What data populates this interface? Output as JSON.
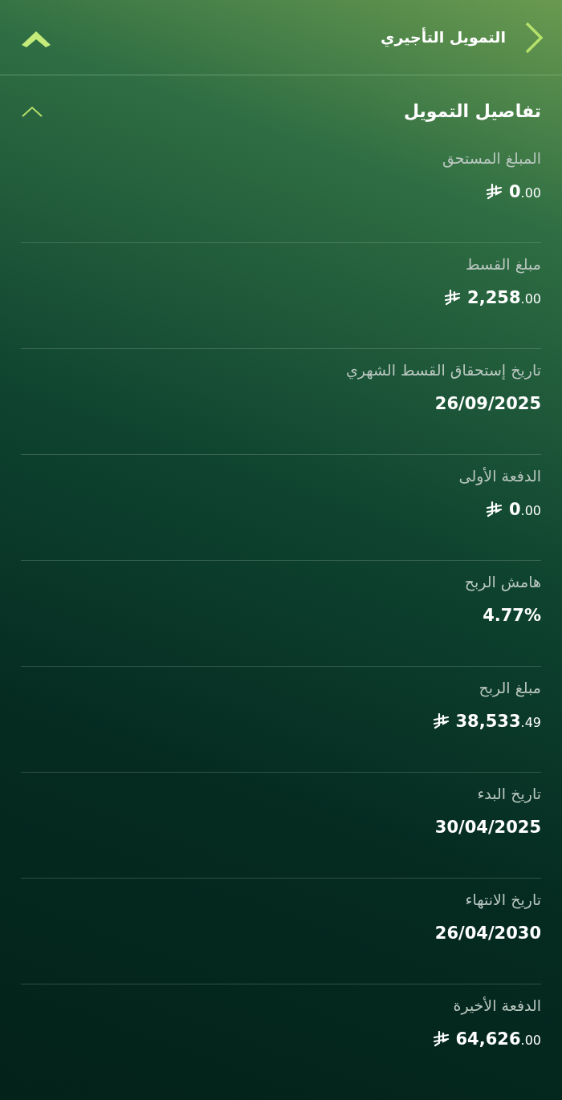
{
  "header": {
    "title": "التمويل التأجيري"
  },
  "section": {
    "title": "تفاصيل التمويل",
    "expanded": true
  },
  "rows": [
    {
      "label": "المبلغ المستحق",
      "kind": "amount",
      "integer": "0",
      "decimals": ".00"
    },
    {
      "label": "مبلغ القسط",
      "kind": "amount",
      "integer": "2,258",
      "decimals": ".00"
    },
    {
      "label": "تاريخ إستحقاق القسط الشهري",
      "kind": "text",
      "value": "26/09/2025"
    },
    {
      "label": "الدفعة الأولى",
      "kind": "amount",
      "integer": "0",
      "decimals": ".00"
    },
    {
      "label": "هامش الربح",
      "kind": "text",
      "value": "4.77%"
    },
    {
      "label": "مبلغ الربح",
      "kind": "amount",
      "integer": "38,533",
      "decimals": ".49"
    },
    {
      "label": "تاريخ البدء",
      "kind": "text",
      "value": "30/04/2025"
    },
    {
      "label": "تاريخ الانتهاء",
      "kind": "text",
      "value": "26/04/2030"
    },
    {
      "label": "الدفعة الأخيرة",
      "kind": "amount",
      "integer": "64,626",
      "decimals": ".00"
    }
  ]
}
